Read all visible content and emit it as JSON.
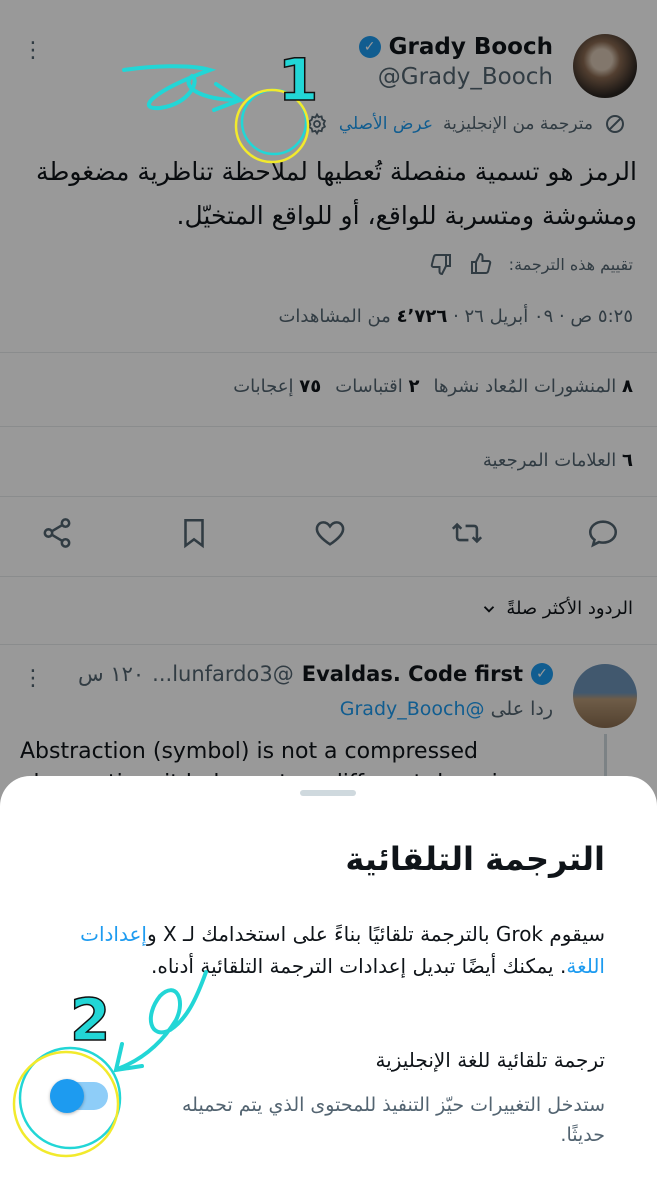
{
  "tweet": {
    "author_name": "Grady Booch",
    "author_handle": "@Grady_Booch",
    "translated_from": "مترجمة من الإنجليزية",
    "show_original": "عرض الأصلي",
    "text": "الرمز هو تسمية منفصلة تُعطيها لملاحظة تناظرية مضغوطة ومشوشة ومتسربة للواقع، أو للواقع المتخيّل.",
    "rate_label": "تقييم هذه الترجمة:",
    "time": "٥:٢٥ ص · ٠٩ أبريل ٢٦ ·",
    "views_count": "٤٬٧٢٦",
    "views_label": "من المشاهدات",
    "reposts_count": "٨",
    "reposts_label": "المنشورات المُعاد نشرها",
    "quotes_count": "٢",
    "quotes_label": "اقتباسات",
    "likes_count": "٧٥",
    "likes_label": "إعجابات",
    "bookmarks_count": "٦",
    "bookmarks_label": "العلامات المرجعية",
    "sort_label": "الردود الأكثر صلةً"
  },
  "reply": {
    "name": "Evaldas. Code first",
    "handle": "@lunfardo3...",
    "time": "١٢٠ س",
    "replying_to_prefix": "ردا على",
    "replying_to_handle": "@Grady_Booch",
    "text": "Abstraction (symbol) is not a compressed observation, it belongs to a different domain"
  },
  "sheet": {
    "title": "الترجمة التلقائية",
    "desc_part1": "سيقوم Grok بالترجمة تلقائيًا بناءً على استخدامك لـ X و",
    "desc_link": "إعدادات اللغة",
    "desc_part2": ". يمكنك أيضًا تبديل إعدادات الترجمة التلقائية أدناه.",
    "setting_title": "ترجمة تلقائية للغة الإنجليزية",
    "setting_desc": "ستدخل التغييرات حيّز التنفيذ للمحتوى الذي يتم تحميله حديثًا.",
    "toggle_on": true
  },
  "annotations": {
    "label1": "1",
    "label2": "2"
  },
  "colors": {
    "accent": "#1d9bf0",
    "annotation_cyan": "#22d6d6",
    "annotation_yellow": "#f2ea2c"
  },
  "icons": [
    "more-vertical-icon",
    "verified-badge-icon",
    "translate-icon",
    "gear-icon",
    "thumbs-up-icon",
    "thumbs-down-icon",
    "share-icon",
    "bookmark-icon",
    "heart-icon",
    "repost-icon",
    "reply-icon",
    "chevron-down-icon"
  ]
}
